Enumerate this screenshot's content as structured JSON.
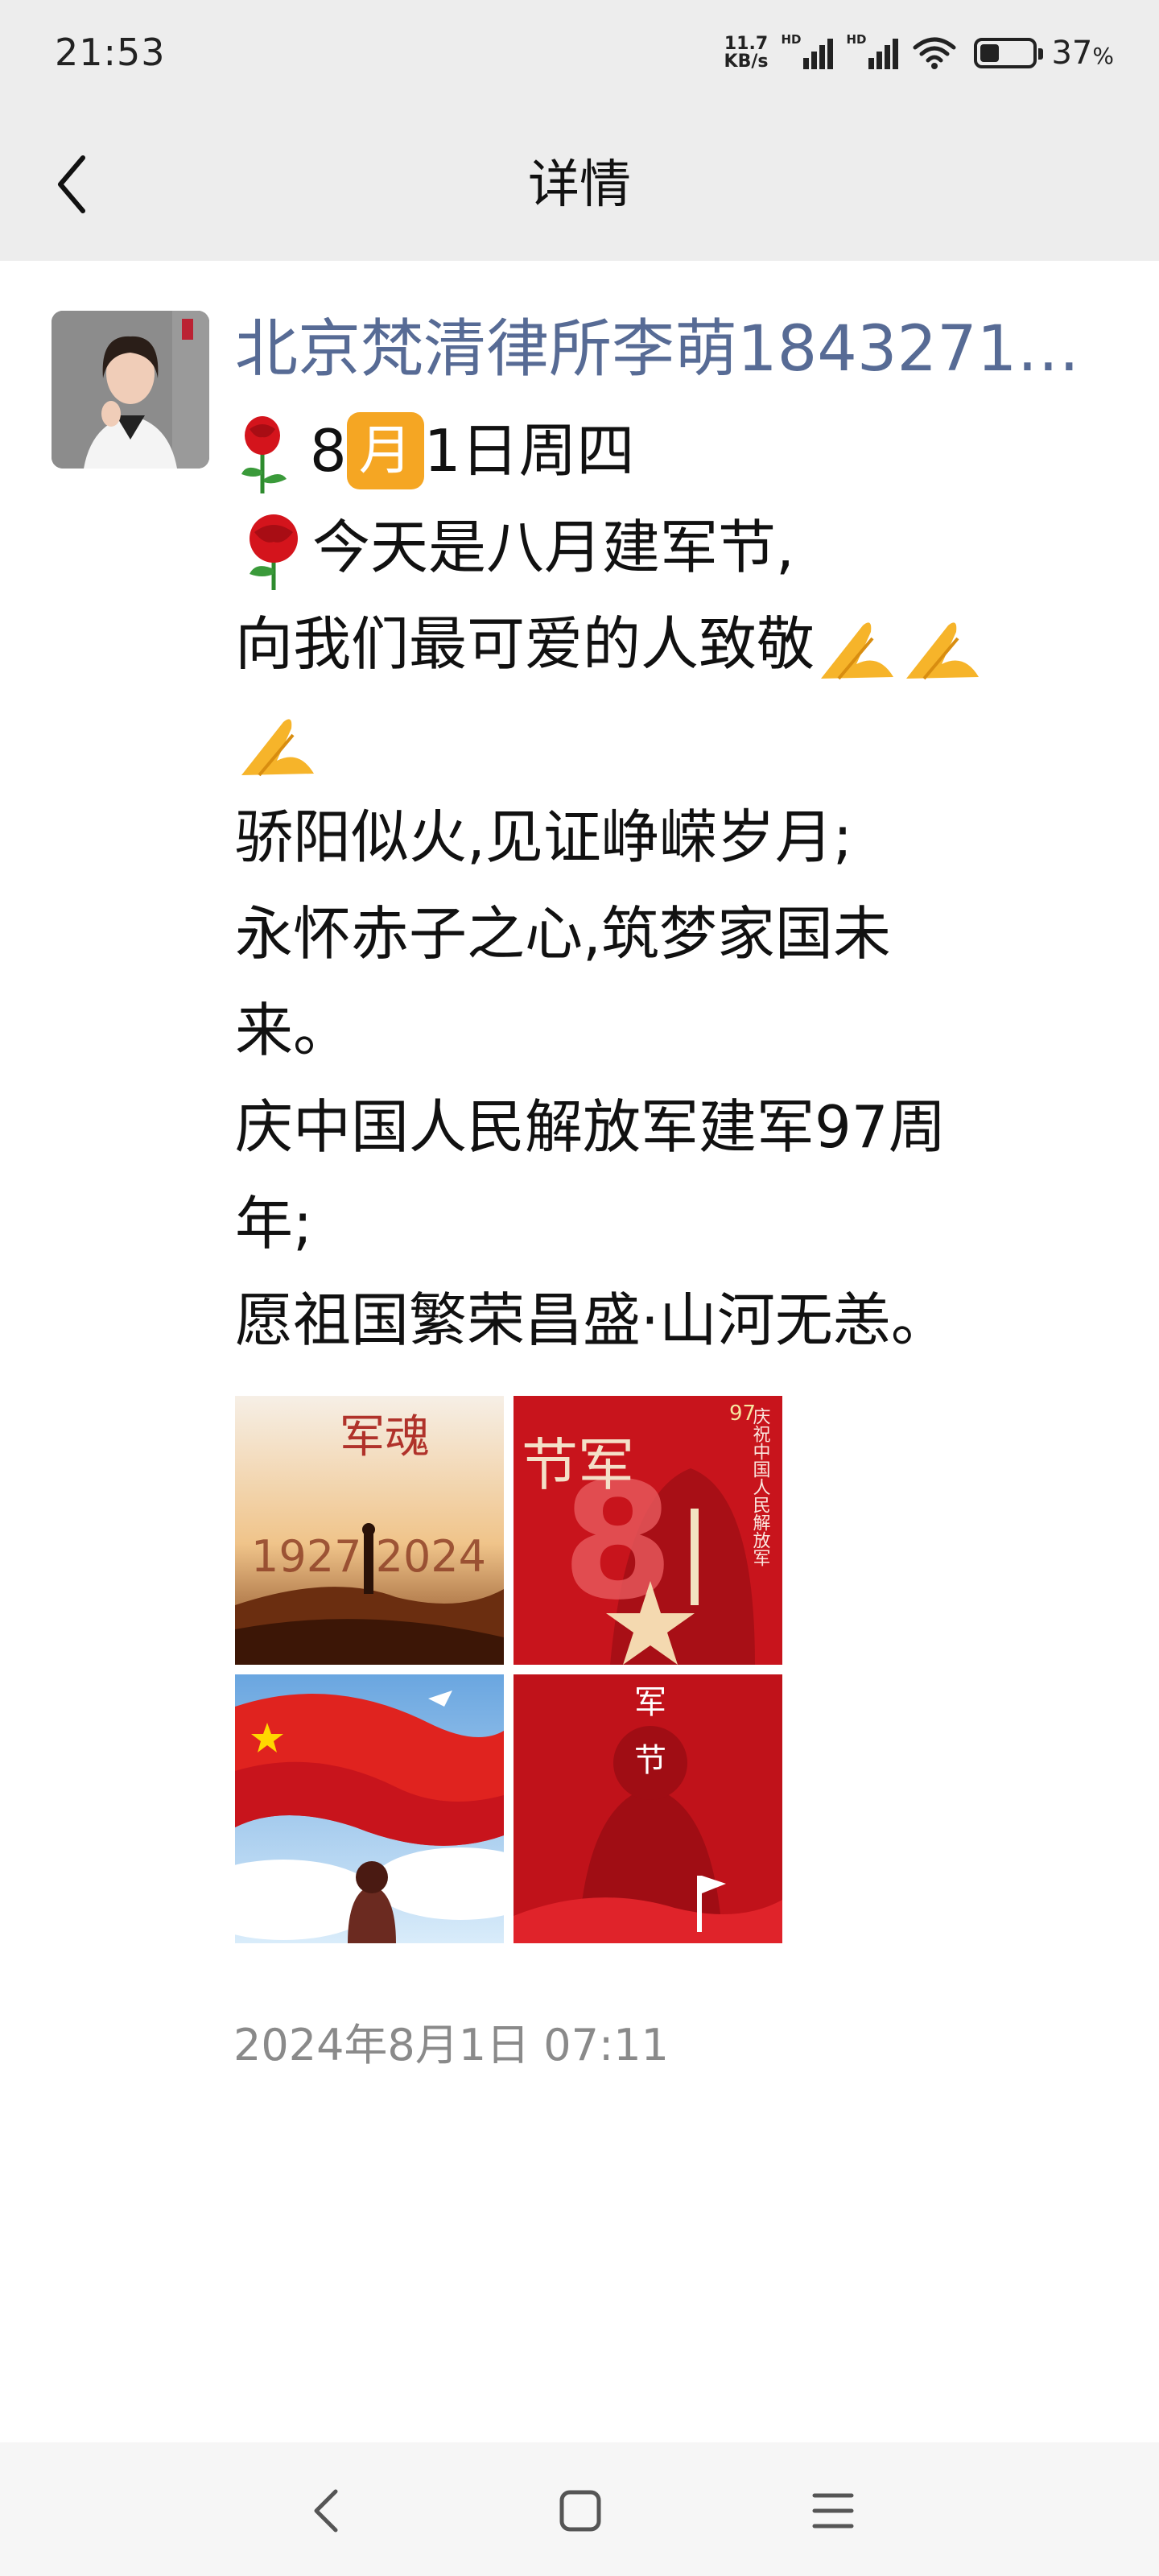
{
  "status_bar": {
    "time": "21:53",
    "net_speed_value": "11.7",
    "net_speed_unit": "KB/s",
    "signal_label_1": "HD",
    "signal_label_2": "HD",
    "battery_value": "37",
    "battery_unit": "%",
    "battery_level": 0.37
  },
  "header": {
    "title": "详情"
  },
  "post": {
    "author": "北京梵清律所李萌18432714…",
    "lines": {
      "l1_a": "8",
      "l1_badge": "月",
      "l1_b": "1日周四",
      "l2": "今天是八月建军节,",
      "l3": "向我们最可爱的人致敬",
      "l5": "骄阳似火,见证峥嵘岁月;",
      "l6": "永怀赤子之心,筑梦家国未",
      "l7": "来。",
      "l8": "庆中国人民解放军建军97周",
      "l9": "年;",
      "l10": "愿祖国繁荣昌盛·山河无恙。"
    },
    "photos": {
      "p1_title": "军魂",
      "p1_years": "1927 2024",
      "p2_title": "节军",
      "p2_side": "庆祝中国人民解放军",
      "p2_badge": "97",
      "p2_big": "8",
      "p3_caption": "",
      "p4_title_1": "军",
      "p4_title_2": "节"
    },
    "timestamp": "2024年8月1日 07:11"
  },
  "colors": {
    "author_link": "#576b95",
    "bar_bg": "#ededed",
    "timestamp": "#8a8a8a",
    "badge": "#f5a623",
    "festival_red": "#c8141c"
  },
  "icons": [
    "back-icon",
    "rose-icon",
    "pray-hands-icon",
    "wifi-icon",
    "battery-icon",
    "nav-back-icon",
    "nav-home-icon",
    "nav-menu-icon"
  ]
}
